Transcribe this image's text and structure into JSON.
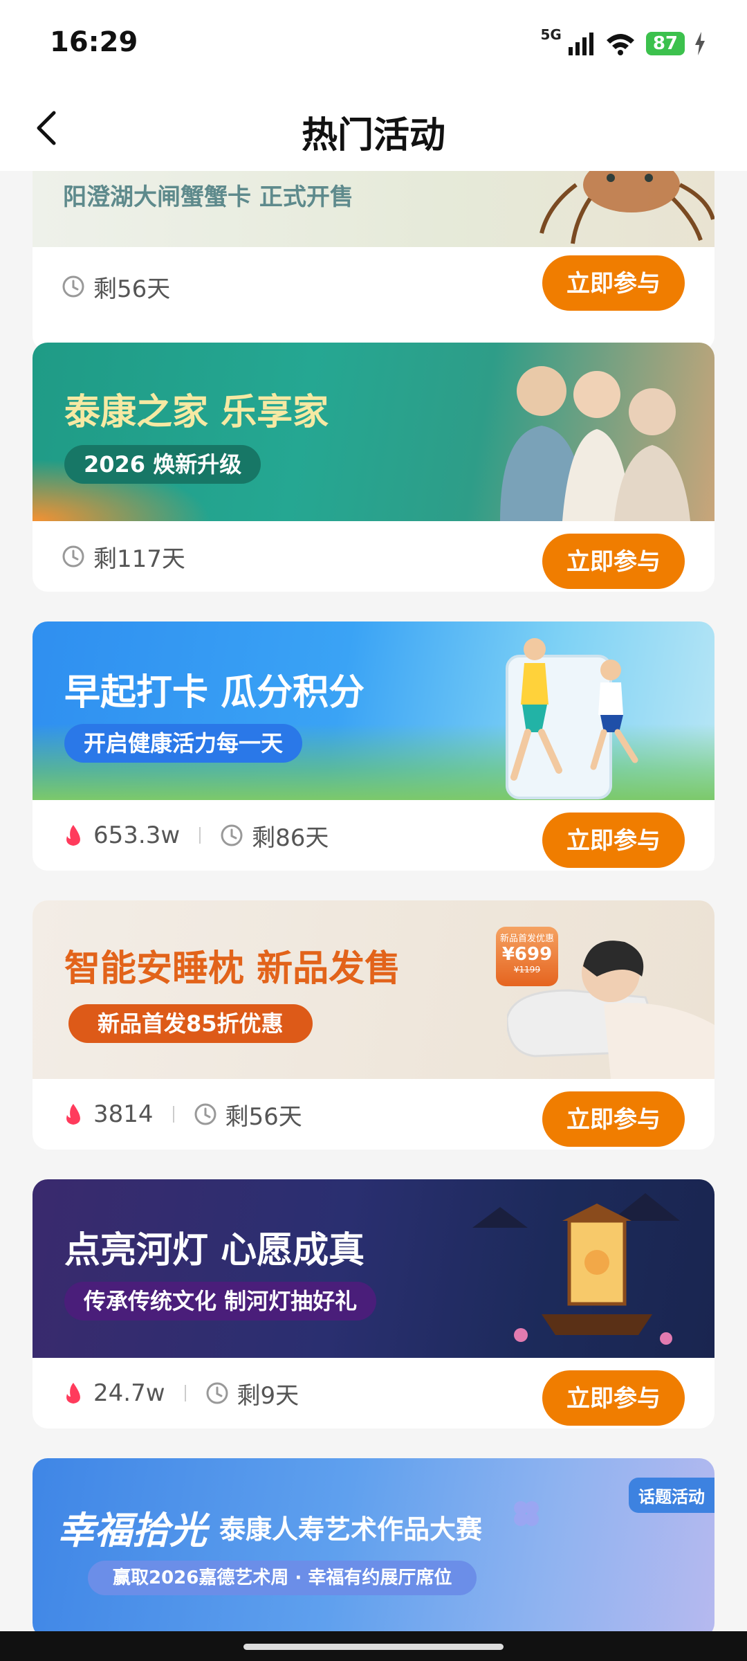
{
  "status": {
    "time": "16:29",
    "network": "5G",
    "battery": "87",
    "icons": [
      "signal-icon",
      "wifi-icon",
      "battery-icon",
      "charging-icon"
    ]
  },
  "header": {
    "title": "热门活动",
    "back_icon": "back-arrow-icon"
  },
  "cards": [
    {
      "banner_text": "阳澄湖大闸蟹蟹卡 正式开售",
      "remaining": "剩56天",
      "button": "立即参与"
    },
    {
      "banner_title": "泰康之家 乐享家",
      "banner_pill": "2026 焕新升级",
      "remaining": "剩117天",
      "button": "立即参与"
    },
    {
      "banner_title": "早起打卡  瓜分积分",
      "banner_pill": "开启健康活力每一天",
      "heat": "653.3w",
      "remaining": "剩86天",
      "button": "立即参与"
    },
    {
      "banner_title": "智能安睡枕 新品发售",
      "banner_pill": "新品首发85折优惠",
      "badge_top": "新品首发优惠",
      "badge_price": "¥699",
      "badge_orig": "¥1199",
      "heat": "3814",
      "remaining": "剩56天",
      "button": "立即参与"
    },
    {
      "banner_title": "点亮河灯 心愿成真",
      "banner_pill": "传承传统文化  制河灯抽好礼",
      "heat": "24.7w",
      "remaining": "剩9天",
      "button": "立即参与"
    },
    {
      "banner_title_script": "幸福拾光",
      "banner_title": "泰康人寿艺术作品大赛",
      "banner_pill": "赢取2026嘉德艺术周 · 幸福有约展厅席位",
      "tag": "话题活动"
    }
  ],
  "colors": {
    "accent": "#f07d00",
    "heat": "#ff3b5c"
  }
}
